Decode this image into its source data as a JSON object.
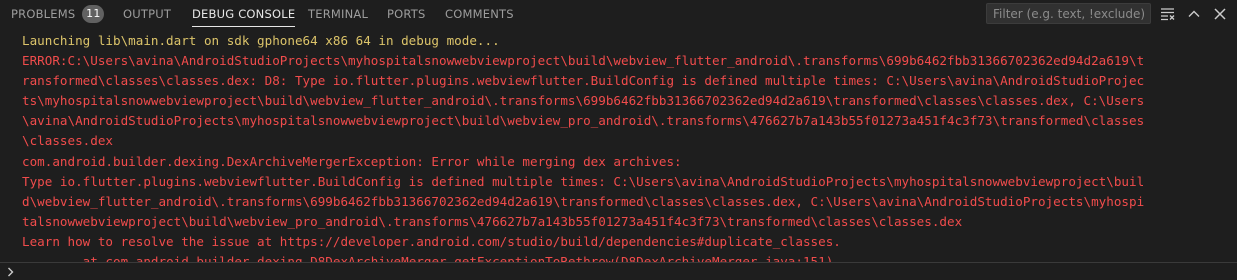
{
  "tabs": {
    "problems": "PROBLEMS",
    "problems_count": "11",
    "output": "OUTPUT",
    "debug_console": "DEBUG CONSOLE",
    "terminal": "TERMINAL",
    "ports": "PORTS",
    "comments": "COMMENTS",
    "active": "debug_console"
  },
  "filter": {
    "placeholder": "Filter (e.g. text, !exclude)",
    "value": ""
  },
  "icons": {
    "filter_clear": "clear-all-icon",
    "maximize": "chevron-up-icon",
    "close": "close-icon",
    "prompt": "chevron-right-icon"
  },
  "colors": {
    "background": "#1e1e1e",
    "warning_text": "#dcc46a",
    "error_text": "#f14c4c",
    "tab_inactive": "#9d9d9d",
    "tab_active": "#e7e7e7",
    "badge": "#616161"
  },
  "console": {
    "lines": [
      "Launching lib\\main.dart on sdk gphone64 x86 64 in debug mode...",
      "ERROR:C:\\Users\\avina\\AndroidStudioProjects\\myhospitalsnowwebviewproject\\build\\webview_flutter_android\\.transforms\\699b6462fbb31366702362ed94d2a619\\t",
      "ransformed\\classes\\classes.dex: D8: Type io.flutter.plugins.webviewflutter.BuildConfig is defined multiple times: C:\\Users\\avina\\AndroidStudioProjec",
      "ts\\myhospitalsnowwebviewproject\\build\\webview_flutter_android\\.transforms\\699b6462fbb31366702362ed94d2a619\\transformed\\classes\\classes.dex, C:\\Users",
      "\\avina\\AndroidStudioProjects\\myhospitalsnowwebviewproject\\build\\webview_pro_android\\.transforms\\476627b7a143b55f01273a451f4c3f73\\transformed\\classes",
      "\\classes.dex",
      "com.android.builder.dexing.DexArchiveMergerException: Error while merging dex archives:",
      "Type io.flutter.plugins.webviewflutter.BuildConfig is defined multiple times: C:\\Users\\avina\\AndroidStudioProjects\\myhospitalsnowwebviewproject\\buil",
      "d\\webview_flutter_android\\.transforms\\699b6462fbb31366702362ed94d2a619\\transformed\\classes\\classes.dex, C:\\Users\\avina\\AndroidStudioProjects\\myhospi",
      "talsnowwebviewproject\\build\\webview_pro_android\\.transforms\\476627b7a143b55f01273a451f4c3f73\\transformed\\classes\\classes.dex",
      "Learn how to resolve the issue at https://developer.android.com/studio/build/dependencies#duplicate_classes.",
      "\tat com.android.builder.dexing.D8DexArchiveMerger.getExceptionToRethrow(D8DexArchiveMerger.java:151)"
    ]
  }
}
